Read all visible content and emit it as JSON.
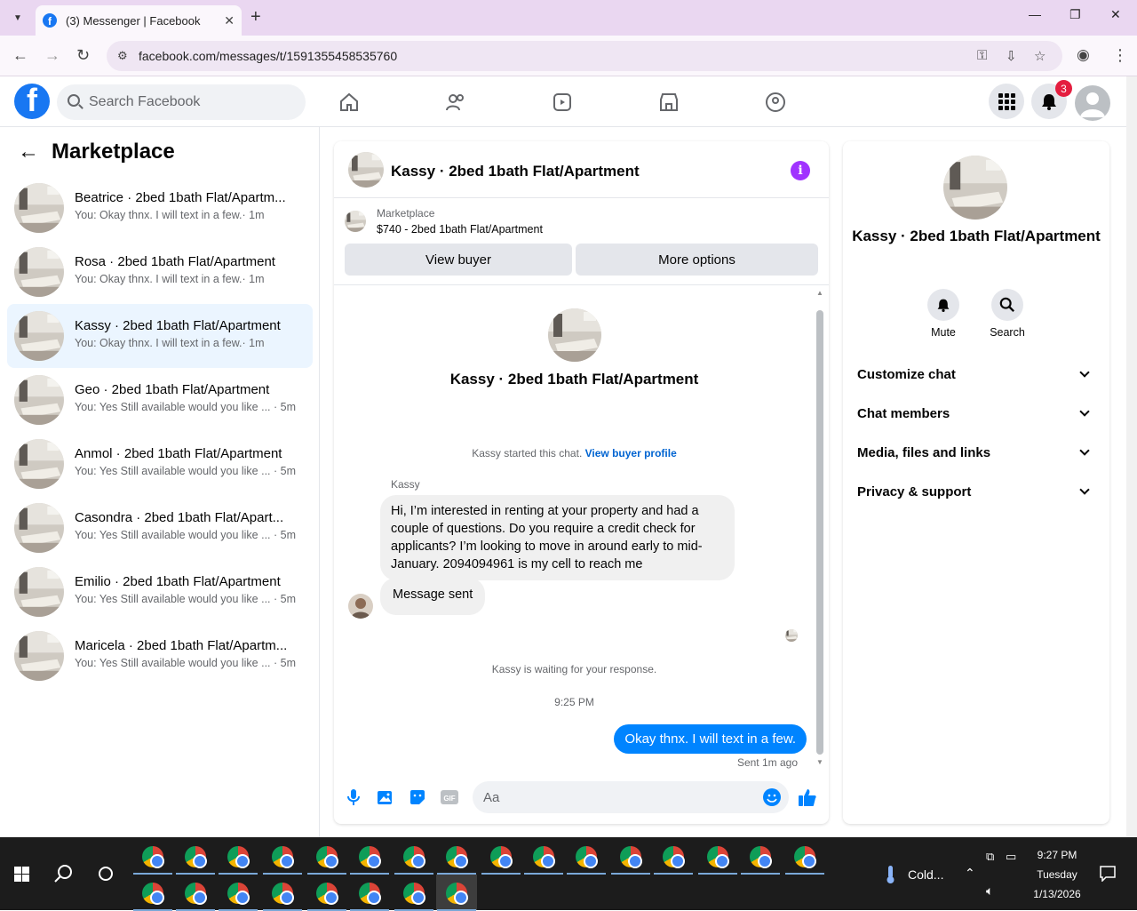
{
  "browser": {
    "tab_title": "(3) Messenger | Facebook",
    "url": "facebook.com/messages/t/1591355458535760"
  },
  "fb_header": {
    "search_placeholder": "Search Facebook",
    "notification_count": "3"
  },
  "sidebar": {
    "title": "Marketplace",
    "conversations": [
      {
        "name": "Beatrice · 2bed 1bath Flat/Apartm...",
        "preview": "You: Okay thnx. I will text in a few.· 1m"
      },
      {
        "name": "Rosa · 2bed 1bath Flat/Apartment",
        "preview": "You: Okay thnx. I will text in a few.· 1m"
      },
      {
        "name": "Kassy · 2bed 1bath Flat/Apartment",
        "preview": "You: Okay thnx. I will text in a few.· 1m"
      },
      {
        "name": "Geo · 2bed 1bath Flat/Apartment",
        "preview": "You: Yes Still available would you like ... · 5m"
      },
      {
        "name": "Anmol · 2bed 1bath Flat/Apartment",
        "preview": "You: Yes Still available would you like ... · 5m"
      },
      {
        "name": "Casondra · 2bed 1bath Flat/Apart...",
        "preview": "You: Yes Still available would you like ... · 5m"
      },
      {
        "name": "Emilio · 2bed 1bath Flat/Apartment",
        "preview": "You: Yes Still available would you like ... · 5m"
      },
      {
        "name": "Maricela · 2bed 1bath Flat/Apartm...",
        "preview": "You: Yes Still available would you like ... · 5m"
      }
    ]
  },
  "chat": {
    "title": "Kassy · 2bed 1bath Flat/Apartment",
    "listing_kicker": "Marketplace",
    "listing_title": "$740 - 2bed 1bath Flat/Apartment",
    "view_buyer": "View buyer",
    "more_options": "More options",
    "center_name": "Kassy · 2bed 1bath Flat/Apartment",
    "started_text": "Kassy started this chat.",
    "view_buyer_profile": "View buyer profile",
    "sender": "Kassy",
    "incoming_message": "Hi, I’m interested in renting at your property and had a couple of questions. Do you require a credit check for applicants? I’m looking to move in around early to mid-January. 2094094961 is my cell to reach me",
    "message_sent": "Message sent",
    "waiting_text": "Kassy is waiting for your response.",
    "timestamp": "9:25 PM",
    "outgoing_message": "Okay thnx. I will text in a few.",
    "sent_meta": "Sent 1m ago",
    "composer_placeholder": "Aa"
  },
  "right_panel": {
    "name": "Kassy · 2bed 1bath Flat/Apartment",
    "mute": "Mute",
    "search": "Search",
    "sections": [
      "Customize chat",
      "Chat members",
      "Media, files and links",
      "Privacy & support"
    ]
  },
  "taskbar": {
    "weather": "Cold...",
    "time": "9:27 PM",
    "day": "Tuesday",
    "date": "1/13/2026"
  },
  "colors": {
    "fb_blue": "#1877f2",
    "messenger_blue": "#0084ff",
    "info_purple": "#a033ff",
    "badge_red": "#e41e3f"
  }
}
